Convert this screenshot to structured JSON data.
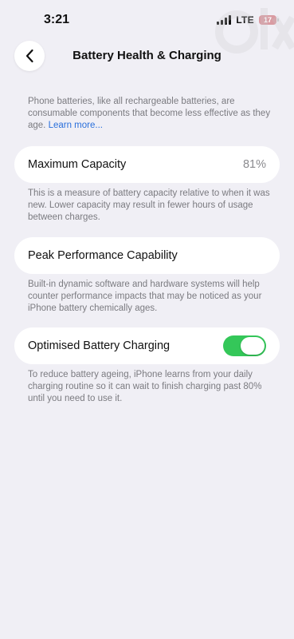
{
  "status_bar": {
    "time": "3:21",
    "network": "LTE",
    "battery_level": "17"
  },
  "nav": {
    "title": "Battery Health & Charging",
    "back_icon": "chevron-left-icon"
  },
  "intro": {
    "text": "Phone batteries, like all rechargeable batteries, are consumable components that become less effective as they age. ",
    "link": "Learn more..."
  },
  "max_capacity": {
    "label": "Maximum Capacity",
    "value": "81%",
    "footnote": "This is a measure of battery capacity relative to when it was new. Lower capacity may result in fewer hours of usage between charges."
  },
  "peak_performance": {
    "label": "Peak Performance Capability",
    "footnote": "Built-in dynamic software and hardware systems will help counter performance impacts that may be noticed as your iPhone battery chemically ages."
  },
  "optimised_charging": {
    "label": "Optimised Battery Charging",
    "enabled": true,
    "footnote": "To reduce battery ageing, iPhone learns from your daily charging routine so it can wait to finish charging past 80% until you need to use it."
  },
  "colors": {
    "background": "#f0eff5",
    "toggle_on": "#34c759",
    "link": "#2a6fdb",
    "battery_low": "#d99ba2"
  }
}
